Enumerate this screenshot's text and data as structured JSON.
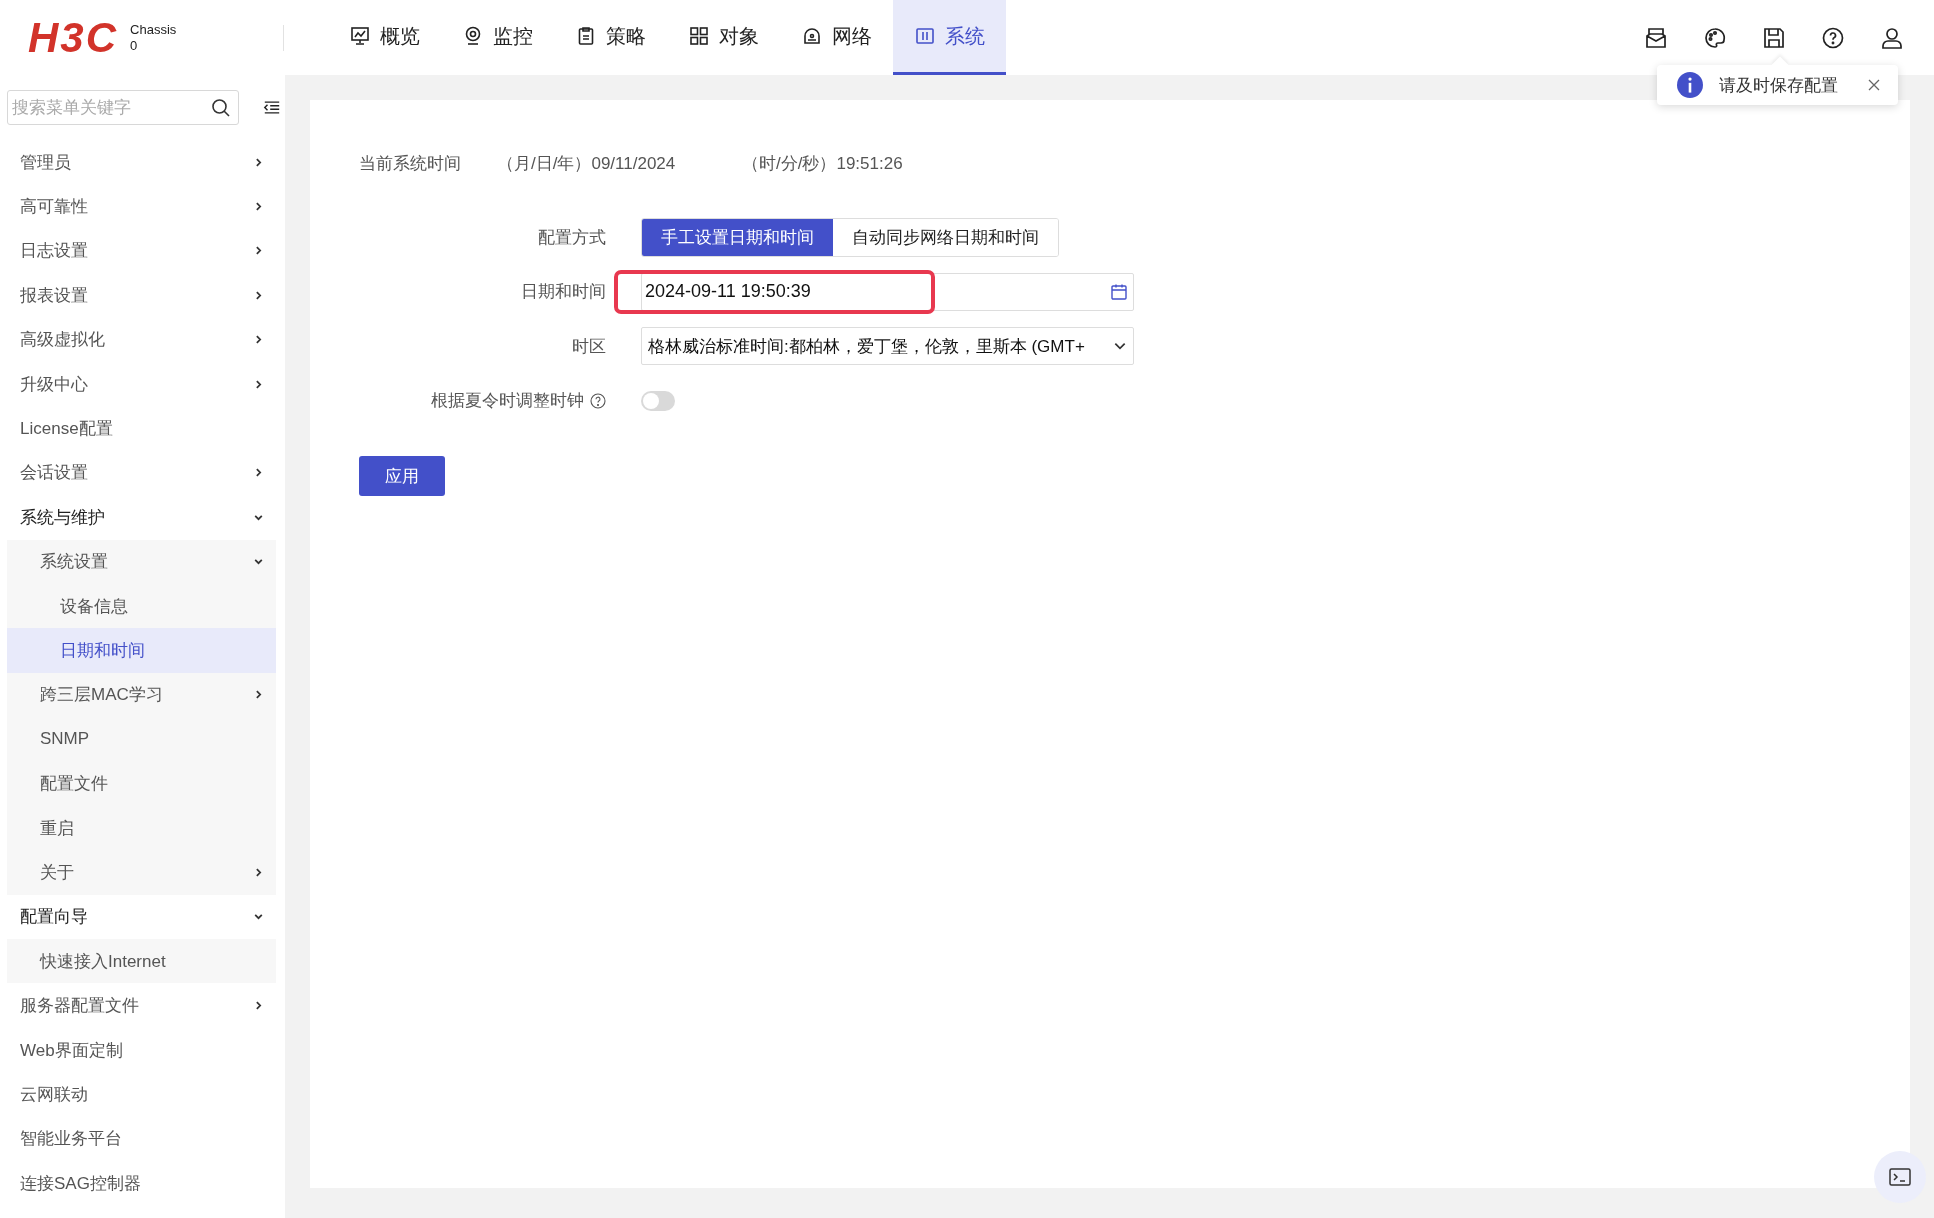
{
  "header": {
    "logo": "H3C",
    "device": {
      "name": "Chassis",
      "slot": "0"
    },
    "nav": [
      {
        "label": "概览",
        "selected": false
      },
      {
        "label": "监控",
        "selected": false
      },
      {
        "label": "策略",
        "selected": false
      },
      {
        "label": "对象",
        "selected": false
      },
      {
        "label": "网络",
        "selected": false
      },
      {
        "label": "系统",
        "selected": true
      }
    ],
    "notice": {
      "text": "请及时保存配置"
    }
  },
  "sidebar": {
    "search": {
      "placeholder": "搜索菜单关键字"
    },
    "items": [
      {
        "label": "管理员",
        "expanded": false
      },
      {
        "label": "高可靠性",
        "expanded": false
      },
      {
        "label": "日志设置",
        "expanded": false
      },
      {
        "label": "报表设置",
        "expanded": false
      },
      {
        "label": "高级虚拟化",
        "expanded": false
      },
      {
        "label": "升级中心",
        "expanded": false
      },
      {
        "label": "License配置",
        "selected": false
      },
      {
        "label": "会话设置",
        "expanded": false
      },
      {
        "label": "系统与维护",
        "expanded": true,
        "children": [
          {
            "label": "系统设置",
            "expanded": true,
            "children": [
              {
                "label": "设备信息",
                "selected": false
              },
              {
                "label": "日期和时间",
                "selected": true
              }
            ]
          },
          {
            "label": "跨三层MAC学习",
            "expanded": false
          },
          {
            "label": "SNMP",
            "selected": false
          },
          {
            "label": "配置文件",
            "selected": false
          },
          {
            "label": "重启",
            "selected": false
          },
          {
            "label": "关于",
            "expanded": false
          }
        ]
      },
      {
        "label": "配置向导",
        "expanded": true,
        "children": [
          {
            "label": "快速接入Internet",
            "selected": false
          }
        ]
      },
      {
        "label": "服务器配置文件",
        "expanded": false
      },
      {
        "label": "Web界面定制",
        "selected": false
      },
      {
        "label": "云网联动",
        "selected": false
      },
      {
        "label": "智能业务平台",
        "selected": false
      },
      {
        "label": "连接SAG控制器",
        "selected": false
      }
    ]
  },
  "content": {
    "current_time": {
      "label": "当前系统时间",
      "date": "（月/日/年）09/11/2024",
      "time": "（时/分/秒）19:51:26"
    },
    "mode": {
      "label": "配置方式",
      "options": [
        {
          "label": "手工设置日期和时间",
          "selected": true
        },
        {
          "label": "自动同步网络日期和时间",
          "selected": false
        }
      ]
    },
    "datetime": {
      "label": "日期和时间",
      "value": "2024-09-11 19:50:39",
      "highlighted": true
    },
    "timezone": {
      "label": "时区",
      "value": "格林威治标准时间:都柏林，爱丁堡，伦敦，里斯本 (GMT+"
    },
    "dst": {
      "label": "根据夏令时调整时钟",
      "on": false
    },
    "apply_button": "应用"
  }
}
